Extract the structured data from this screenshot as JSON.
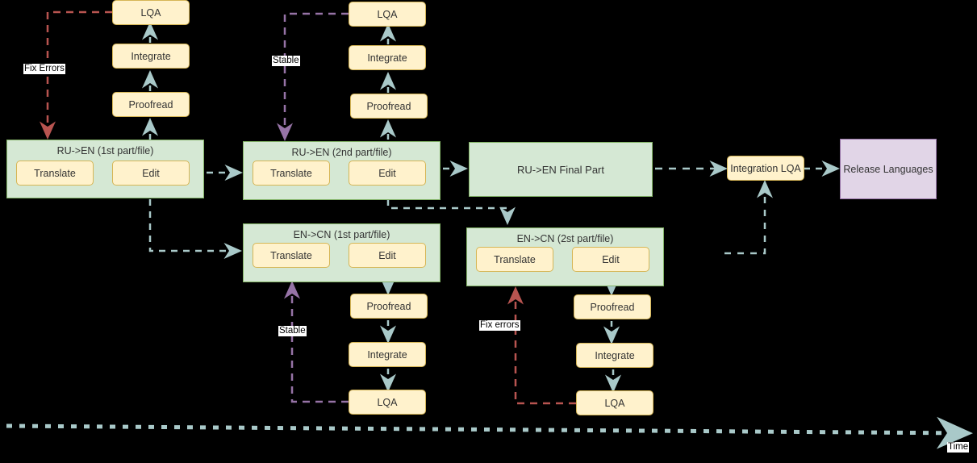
{
  "colors": {
    "background": "#000000",
    "cluster_fill": "#d5e8d4",
    "cluster_stroke": "#82b366",
    "node_fill": "#fff2cc",
    "node_stroke": "#d6b656",
    "release_fill": "#e1d5e7",
    "release_stroke": "#9673a6",
    "flow_edge": "#a9c9c9",
    "fix_edge": "#b85450",
    "stable_edge": "#9673a6",
    "text": "#333333"
  },
  "clusters": [
    {
      "id": "ru-en-1",
      "title": "RU->EN (1st part/file)",
      "nodes": [
        {
          "id": "ru1-translate",
          "label": "Translate"
        },
        {
          "id": "ru1-edit",
          "label": "Edit"
        }
      ]
    },
    {
      "id": "ru-en-2",
      "title": "RU->EN (2nd part/file)",
      "nodes": [
        {
          "id": "ru2-translate",
          "label": "Translate"
        },
        {
          "id": "ru2-edit",
          "label": "Edit"
        }
      ]
    },
    {
      "id": "en-cn-1",
      "title": "EN->CN (1st part/file)",
      "nodes": [
        {
          "id": "cn1-translate",
          "label": "Translate"
        },
        {
          "id": "cn1-edit",
          "label": "Edit"
        }
      ]
    },
    {
      "id": "en-cn-2",
      "title": "EN->CN (2st part/file)",
      "nodes": [
        {
          "id": "cn2-translate",
          "label": "Translate"
        },
        {
          "id": "cn2-edit",
          "label": "Edit"
        }
      ]
    }
  ],
  "qa_chain_ru1": [
    {
      "id": "ru1-proofread",
      "label": "Proofread"
    },
    {
      "id": "ru1-integrate",
      "label": "Integrate"
    },
    {
      "id": "ru1-lqa",
      "label": "LQA"
    }
  ],
  "qa_chain_ru2": [
    {
      "id": "ru2-proofread",
      "label": "Proofread"
    },
    {
      "id": "ru2-integrate",
      "label": "Integrate"
    },
    {
      "id": "ru2-lqa",
      "label": "LQA"
    }
  ],
  "qa_chain_cn1": [
    {
      "id": "cn1-proofread",
      "label": "Proofread"
    },
    {
      "id": "cn1-integrate",
      "label": "Integrate"
    },
    {
      "id": "cn1-lqa",
      "label": "LQA"
    }
  ],
  "qa_chain_cn2": [
    {
      "id": "cn2-proofread",
      "label": "Proofread"
    },
    {
      "id": "cn2-integrate",
      "label": "Integrate"
    },
    {
      "id": "cn2-lqa",
      "label": "LQA"
    }
  ],
  "standalone": {
    "final_part": "RU->EN Final Part",
    "integration_lqa": "Integration LQA",
    "release": "Release Languages"
  },
  "edge_labels": {
    "fix_errors_top": "Fix Errors",
    "stable_top": "Stable",
    "stable_bottom": "Stable",
    "fix_errors_bottom": "Fix errors"
  },
  "axis": {
    "label": "Time"
  }
}
